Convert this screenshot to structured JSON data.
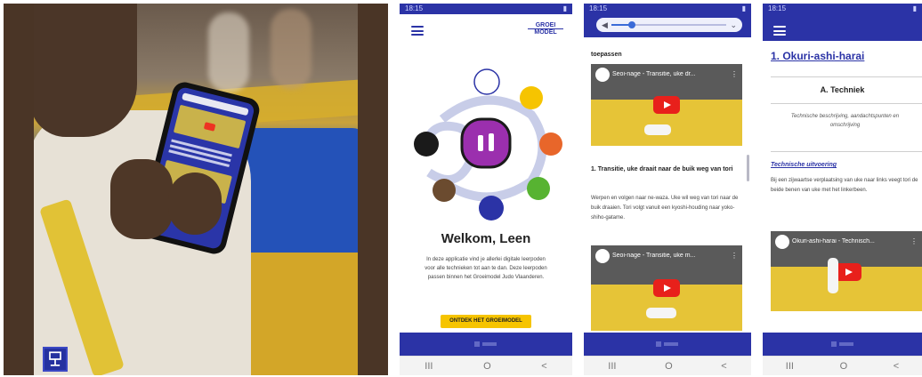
{
  "colors": {
    "primary": "#2b33a6",
    "accent": "#f6c400",
    "youtube": "#e8201b"
  },
  "photo": {
    "alt_icon": "judo-logo-icon"
  },
  "statusbar": {
    "time": "18:15"
  },
  "nav": {
    "recent": "III",
    "home": "O",
    "back": "<"
  },
  "welcome_screen": {
    "brand_line1": "GROEI",
    "brand_line2": "MODEL",
    "heading": "Welkom, Leen",
    "intro": "In deze applicatie vind je allerlei digitale leerpoden voor alle technieken tot aan te dan. Deze leerpoden passen binnen het Groeimodel Judo Vlaanderen.",
    "cta_label": "ONTDEK HET GROEIMODEL"
  },
  "video_screen": {
    "section_label": "toepassen",
    "video1_title": "Seoi-nage - Transitie, uke dr...",
    "heading": "1. Transitie, uke draait naar de buik weg van tori",
    "paragraph": "Werpen en volgen naar ne-waza. Uke wil weg van tori naar de buik draaien. Tori volgt vanuit een kyoshi-houding naar yoko-shiho-gatame.",
    "video2_title": "Seoi-nage - Transitie, uke m...",
    "volume_level": 0.18
  },
  "technique_screen": {
    "title": "1. Okuri-ashi-harai",
    "subheading": "A. Techniek",
    "description": "Technische beschrijving, aandachtspunten en omschrijving",
    "execution_label": "Technische uitvoering",
    "execution_text": "Bij een zijwaartse verplaatsing van uke naar links veegt tori de beide benen van uke met het linkerbeen.",
    "video_title": "Okuri-ashi-harai - Technisch..."
  }
}
